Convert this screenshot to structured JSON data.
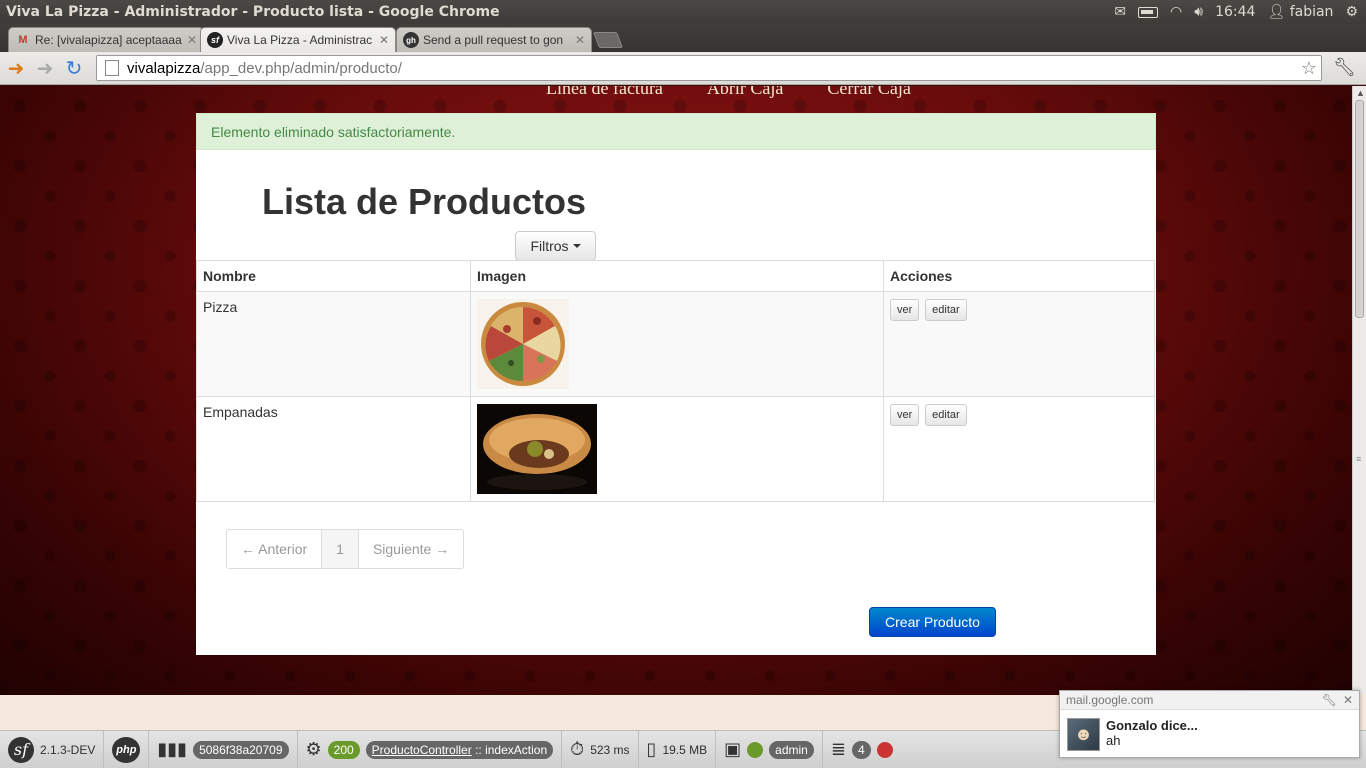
{
  "os": {
    "window_title": "Viva La Pizza - Administrador - Producto lista - Google Chrome",
    "time": "16:44",
    "user": "fabian"
  },
  "browser": {
    "tabs": [
      {
        "label": "Re: [vivalapizza] aceptaaaa",
        "favicon": "M"
      },
      {
        "label": "Viva La Pizza - Administrac",
        "favicon": "sf"
      },
      {
        "label": "Send a pull request to gon",
        "favicon": "gh"
      }
    ],
    "url_host": "vivalapizza",
    "url_path": "/app_dev.php/admin/producto/"
  },
  "page": {
    "nav": [
      "Línea de factura",
      "Abrir Caja",
      "Cerrar Caja"
    ],
    "alert": "Elemento eliminado satisfactoriamente.",
    "title": "Lista de Productos",
    "filter_label": "Filtros",
    "table": {
      "headers": [
        "Nombre",
        "Imagen",
        "Acciones"
      ],
      "rows": [
        {
          "name": "Pizza",
          "image": "pizza",
          "actions": [
            "ver",
            "editar"
          ]
        },
        {
          "name": "Empanadas",
          "image": "empanada",
          "actions": [
            "ver",
            "editar"
          ]
        }
      ]
    },
    "pagination": {
      "prev": "← Anterior",
      "current": "1",
      "next": "Siguiente →"
    },
    "create_label": "Crear Producto"
  },
  "sf_toolbar": {
    "version": "2.1.3-DEV",
    "token": "5086f38a20709",
    "status": "200",
    "controller": "ProductoController",
    "sep": "::",
    "action": "indexAction",
    "time": "523 ms",
    "memory": "19.5 MB",
    "user": "admin",
    "queries": "4"
  },
  "notification": {
    "source": "mail.google.com",
    "sender": "Gonzalo dice...",
    "message": "ah"
  }
}
